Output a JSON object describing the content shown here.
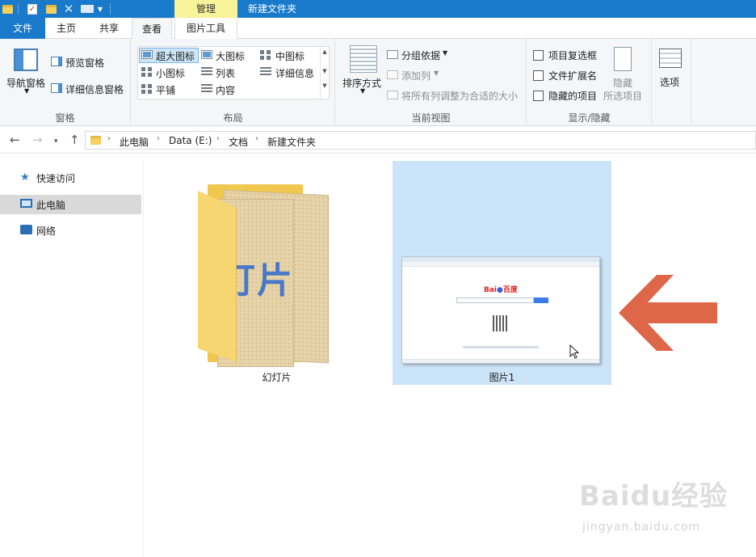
{
  "titlebar": {
    "context_tab": "管理",
    "window_title": "新建文件夹"
  },
  "tabs": [
    {
      "label": "文件"
    },
    {
      "label": "主页"
    },
    {
      "label": "共享"
    },
    {
      "label": "查看"
    },
    {
      "label": "图片工具"
    }
  ],
  "ribbon": {
    "panes": {
      "nav_pane": "导航窗格",
      "preview_pane": "预览窗格",
      "details_pane": "详细信息窗格",
      "group_label": "窗格"
    },
    "layout": {
      "items": [
        "超大图标",
        "大图标",
        "中图标",
        "小图标",
        "列表",
        "详细信息",
        "平铺",
        "内容"
      ],
      "selected": "超大图标",
      "group_label": "布局"
    },
    "current_view": {
      "sort_by": "排序方式",
      "group_by": "分组依据",
      "add_column": "添加列",
      "fit_columns": "将所有列调整为合适的大小",
      "group_label": "当前视图"
    },
    "show_hide": {
      "item_checkboxes": "项目复选框",
      "file_extensions": "文件扩展名",
      "hidden_items": "隐藏的项目",
      "hide_selected_line1": "隐藏",
      "hide_selected_line2": "所选项目",
      "group_label": "显示/隐藏"
    },
    "options": "选项"
  },
  "address": {
    "crumbs": [
      "此电脑",
      "Data (E:)",
      "文档",
      "新建文件夹"
    ]
  },
  "navpane": {
    "items": [
      {
        "label": "快速访问",
        "icon": "star-icon"
      },
      {
        "label": "此电脑",
        "icon": "computer-icon",
        "selected": true
      },
      {
        "label": "网络",
        "icon": "network-icon"
      }
    ]
  },
  "content": {
    "items": [
      {
        "label": "幻灯片",
        "type": "folder",
        "thumbnail_text": "灯片"
      },
      {
        "label": "图片1",
        "type": "image",
        "selected": true
      }
    ]
  },
  "colors": {
    "accent": "#1979ca",
    "context_tab": "#f8f29a",
    "selection": "#cce4f7",
    "arrow": "#dd6748"
  },
  "watermark": {
    "text": "Baidu经验",
    "url": "jingyan.baidu.com"
  }
}
